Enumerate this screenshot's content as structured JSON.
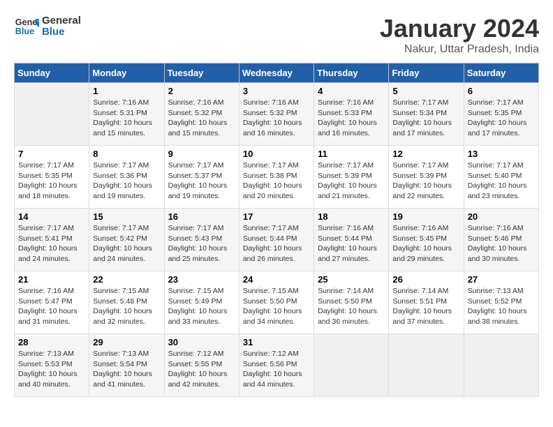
{
  "logo": {
    "line1": "General",
    "line2": "Blue"
  },
  "title": "January 2024",
  "location": "Nakur, Uttar Pradesh, India",
  "weekdays": [
    "Sunday",
    "Monday",
    "Tuesday",
    "Wednesday",
    "Thursday",
    "Friday",
    "Saturday"
  ],
  "weeks": [
    [
      {
        "day": "",
        "sunrise": "",
        "sunset": "",
        "daylight": ""
      },
      {
        "day": "1",
        "sunrise": "Sunrise: 7:16 AM",
        "sunset": "Sunset: 5:31 PM",
        "daylight": "Daylight: 10 hours and 15 minutes."
      },
      {
        "day": "2",
        "sunrise": "Sunrise: 7:16 AM",
        "sunset": "Sunset: 5:32 PM",
        "daylight": "Daylight: 10 hours and 15 minutes."
      },
      {
        "day": "3",
        "sunrise": "Sunrise: 7:16 AM",
        "sunset": "Sunset: 5:32 PM",
        "daylight": "Daylight: 10 hours and 16 minutes."
      },
      {
        "day": "4",
        "sunrise": "Sunrise: 7:16 AM",
        "sunset": "Sunset: 5:33 PM",
        "daylight": "Daylight: 10 hours and 16 minutes."
      },
      {
        "day": "5",
        "sunrise": "Sunrise: 7:17 AM",
        "sunset": "Sunset: 5:34 PM",
        "daylight": "Daylight: 10 hours and 17 minutes."
      },
      {
        "day": "6",
        "sunrise": "Sunrise: 7:17 AM",
        "sunset": "Sunset: 5:35 PM",
        "daylight": "Daylight: 10 hours and 17 minutes."
      }
    ],
    [
      {
        "day": "7",
        "sunrise": "Sunrise: 7:17 AM",
        "sunset": "Sunset: 5:35 PM",
        "daylight": "Daylight: 10 hours and 18 minutes."
      },
      {
        "day": "8",
        "sunrise": "Sunrise: 7:17 AM",
        "sunset": "Sunset: 5:36 PM",
        "daylight": "Daylight: 10 hours and 19 minutes."
      },
      {
        "day": "9",
        "sunrise": "Sunrise: 7:17 AM",
        "sunset": "Sunset: 5:37 PM",
        "daylight": "Daylight: 10 hours and 19 minutes."
      },
      {
        "day": "10",
        "sunrise": "Sunrise: 7:17 AM",
        "sunset": "Sunset: 5:38 PM",
        "daylight": "Daylight: 10 hours and 20 minutes."
      },
      {
        "day": "11",
        "sunrise": "Sunrise: 7:17 AM",
        "sunset": "Sunset: 5:39 PM",
        "daylight": "Daylight: 10 hours and 21 minutes."
      },
      {
        "day": "12",
        "sunrise": "Sunrise: 7:17 AM",
        "sunset": "Sunset: 5:39 PM",
        "daylight": "Daylight: 10 hours and 22 minutes."
      },
      {
        "day": "13",
        "sunrise": "Sunrise: 7:17 AM",
        "sunset": "Sunset: 5:40 PM",
        "daylight": "Daylight: 10 hours and 23 minutes."
      }
    ],
    [
      {
        "day": "14",
        "sunrise": "Sunrise: 7:17 AM",
        "sunset": "Sunset: 5:41 PM",
        "daylight": "Daylight: 10 hours and 24 minutes."
      },
      {
        "day": "15",
        "sunrise": "Sunrise: 7:17 AM",
        "sunset": "Sunset: 5:42 PM",
        "daylight": "Daylight: 10 hours and 24 minutes."
      },
      {
        "day": "16",
        "sunrise": "Sunrise: 7:17 AM",
        "sunset": "Sunset: 5:43 PM",
        "daylight": "Daylight: 10 hours and 25 minutes."
      },
      {
        "day": "17",
        "sunrise": "Sunrise: 7:17 AM",
        "sunset": "Sunset: 5:44 PM",
        "daylight": "Daylight: 10 hours and 26 minutes."
      },
      {
        "day": "18",
        "sunrise": "Sunrise: 7:16 AM",
        "sunset": "Sunset: 5:44 PM",
        "daylight": "Daylight: 10 hours and 27 minutes."
      },
      {
        "day": "19",
        "sunrise": "Sunrise: 7:16 AM",
        "sunset": "Sunset: 5:45 PM",
        "daylight": "Daylight: 10 hours and 29 minutes."
      },
      {
        "day": "20",
        "sunrise": "Sunrise: 7:16 AM",
        "sunset": "Sunset: 5:46 PM",
        "daylight": "Daylight: 10 hours and 30 minutes."
      }
    ],
    [
      {
        "day": "21",
        "sunrise": "Sunrise: 7:16 AM",
        "sunset": "Sunset: 5:47 PM",
        "daylight": "Daylight: 10 hours and 31 minutes."
      },
      {
        "day": "22",
        "sunrise": "Sunrise: 7:15 AM",
        "sunset": "Sunset: 5:48 PM",
        "daylight": "Daylight: 10 hours and 32 minutes."
      },
      {
        "day": "23",
        "sunrise": "Sunrise: 7:15 AM",
        "sunset": "Sunset: 5:49 PM",
        "daylight": "Daylight: 10 hours and 33 minutes."
      },
      {
        "day": "24",
        "sunrise": "Sunrise: 7:15 AM",
        "sunset": "Sunset: 5:50 PM",
        "daylight": "Daylight: 10 hours and 34 minutes."
      },
      {
        "day": "25",
        "sunrise": "Sunrise: 7:14 AM",
        "sunset": "Sunset: 5:50 PM",
        "daylight": "Daylight: 10 hours and 36 minutes."
      },
      {
        "day": "26",
        "sunrise": "Sunrise: 7:14 AM",
        "sunset": "Sunset: 5:51 PM",
        "daylight": "Daylight: 10 hours and 37 minutes."
      },
      {
        "day": "27",
        "sunrise": "Sunrise: 7:13 AM",
        "sunset": "Sunset: 5:52 PM",
        "daylight": "Daylight: 10 hours and 38 minutes."
      }
    ],
    [
      {
        "day": "28",
        "sunrise": "Sunrise: 7:13 AM",
        "sunset": "Sunset: 5:53 PM",
        "daylight": "Daylight: 10 hours and 40 minutes."
      },
      {
        "day": "29",
        "sunrise": "Sunrise: 7:13 AM",
        "sunset": "Sunset: 5:54 PM",
        "daylight": "Daylight: 10 hours and 41 minutes."
      },
      {
        "day": "30",
        "sunrise": "Sunrise: 7:12 AM",
        "sunset": "Sunset: 5:55 PM",
        "daylight": "Daylight: 10 hours and 42 minutes."
      },
      {
        "day": "31",
        "sunrise": "Sunrise: 7:12 AM",
        "sunset": "Sunset: 5:56 PM",
        "daylight": "Daylight: 10 hours and 44 minutes."
      },
      {
        "day": "",
        "sunrise": "",
        "sunset": "",
        "daylight": ""
      },
      {
        "day": "",
        "sunrise": "",
        "sunset": "",
        "daylight": ""
      },
      {
        "day": "",
        "sunrise": "",
        "sunset": "",
        "daylight": ""
      }
    ]
  ]
}
